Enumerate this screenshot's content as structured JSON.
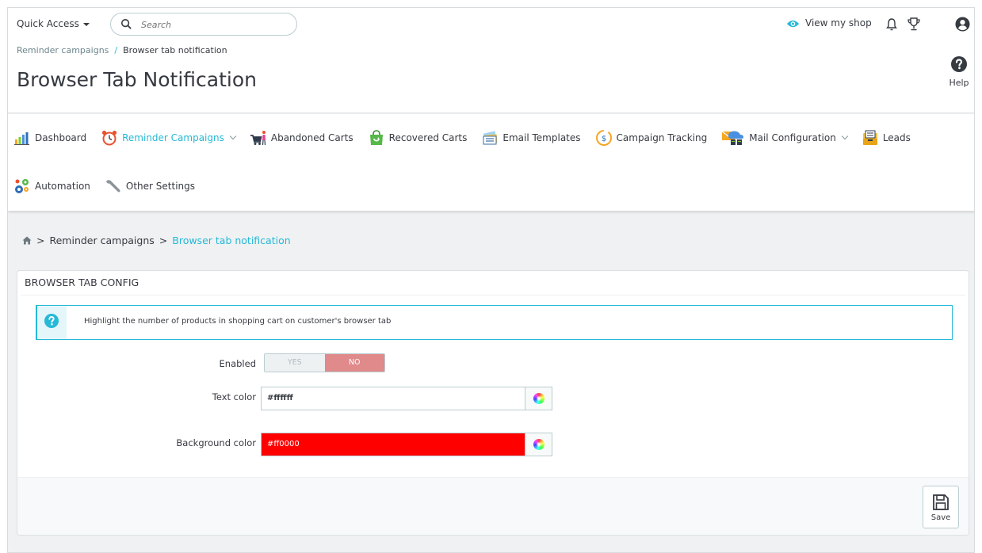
{
  "topbar": {
    "quick_access": "Quick Access",
    "search_placeholder": "Search",
    "view_shop": "View my shop"
  },
  "header": {
    "breadcrumb": [
      "Reminder campaigns",
      "Browser tab notification"
    ],
    "title": "Browser Tab Notification",
    "help": "Help"
  },
  "nav": {
    "items": [
      {
        "label": "Dashboard",
        "icon": "dashboard-chart-icon"
      },
      {
        "label": "Reminder Campaigns",
        "icon": "alarm-clock-icon",
        "active": true,
        "dropdown": true
      },
      {
        "label": "Abandoned Carts",
        "icon": "abandoned-cart-icon"
      },
      {
        "label": "Recovered Carts",
        "icon": "shopping-bag-icon"
      },
      {
        "label": "Email Templates",
        "icon": "email-templates-icon"
      },
      {
        "label": "Campaign Tracking",
        "icon": "campaign-tracking-icon"
      },
      {
        "label": "Mail Configuration",
        "icon": "mail-server-icon",
        "dropdown": true
      },
      {
        "label": "Leads",
        "icon": "leads-inbox-icon"
      },
      {
        "label": "Automation",
        "icon": "gears-icon"
      },
      {
        "label": "Other Settings",
        "icon": "wrench-icon"
      }
    ]
  },
  "content": {
    "breadcrumb": [
      "Reminder campaigns",
      "Browser tab notification"
    ],
    "panel_title": "BROWSER TAB CONFIG",
    "alert": "Highlight the number of products in shopping cart on customer's browser tab",
    "enabled_label": "Enabled",
    "enabled_yes": "YES",
    "enabled_no": "NO",
    "enabled_value": "NO",
    "text_color_label": "Text color",
    "text_color_value": "#ffffff",
    "bg_color_label": "Background color",
    "bg_color_value": "#ff0000",
    "save": "Save"
  },
  "colors": {
    "accent": "#25b9d7",
    "toggle_no": "#e08a8c",
    "background_field": "#ff0000"
  }
}
